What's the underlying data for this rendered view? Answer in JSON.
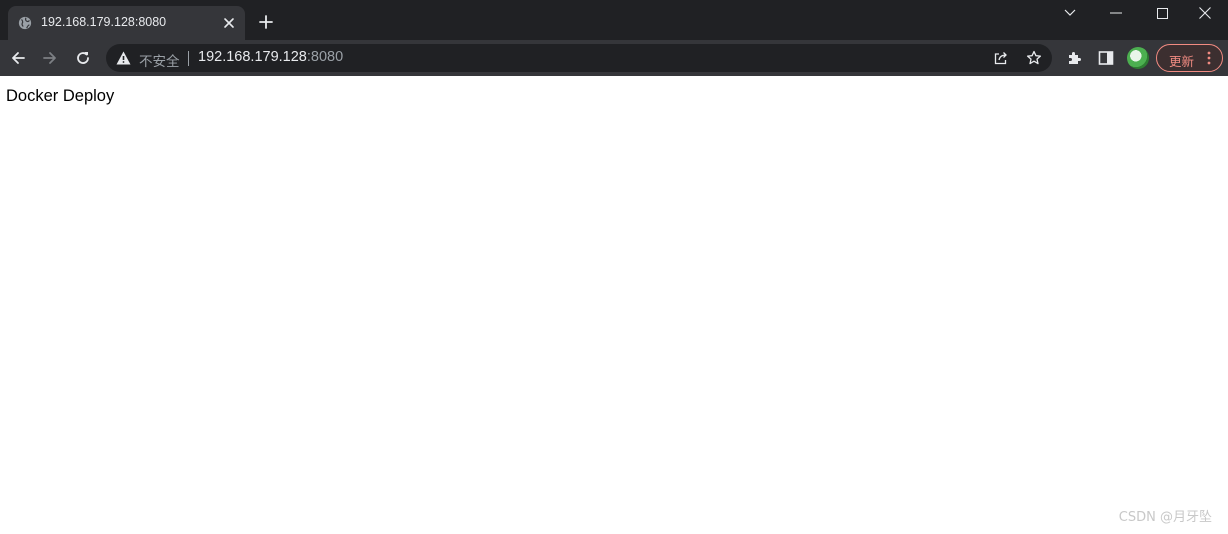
{
  "tab": {
    "title": "192.168.179.128:8080",
    "favicon": "globe-icon"
  },
  "toolbar": {
    "security_label": "不安全",
    "url_host": "192.168.179.128",
    "url_port": ":8080",
    "update_label": "更新"
  },
  "page": {
    "text": "Docker Deploy"
  },
  "watermark": "CSDN @月牙坠",
  "colors": {
    "titlebar_bg": "#202124",
    "tab_bg": "#35363a",
    "omnibox_bg": "#202124",
    "update_accent": "#f28b82"
  }
}
